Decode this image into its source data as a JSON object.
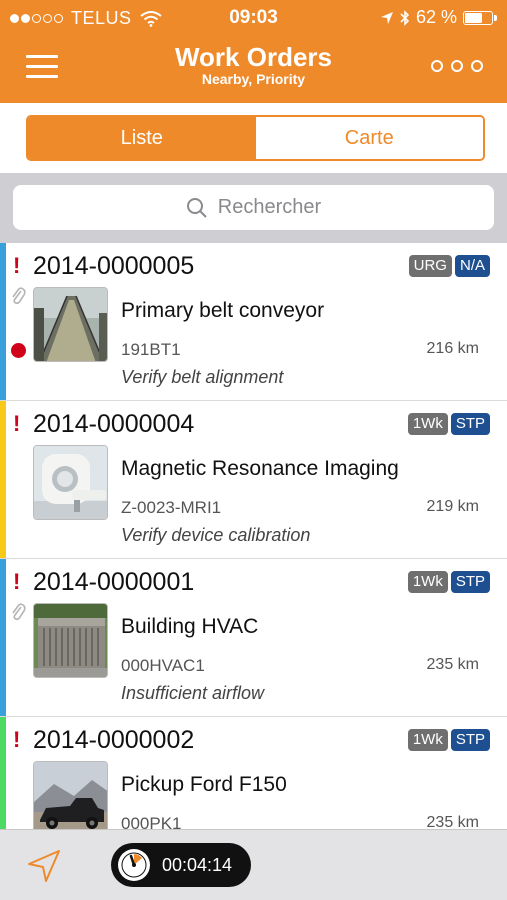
{
  "status_bar": {
    "carrier": "TELUS",
    "time": "09:03",
    "battery": "62 %",
    "battery_level": 0.62,
    "icons": [
      "signal-dots-icon",
      "wifi-icon",
      "location-arrow-icon",
      "bluetooth-icon",
      "battery-icon"
    ]
  },
  "header": {
    "title": "Work Orders",
    "subtitle": "Nearby, Priority",
    "menu_icon": "hamburger-icon",
    "more_icon": "ellipsis-icon"
  },
  "segments": [
    {
      "label": "Liste",
      "active": true
    },
    {
      "label": "Carte",
      "active": false
    }
  ],
  "search": {
    "placeholder": "Rechercher",
    "icon": "search-icon"
  },
  "colors": {
    "accent": "#ef8a2a",
    "priority_bar_blue": "#3aa0dc",
    "priority_bar_yellow": "#f7c918",
    "priority_bar_green": "#4cd964",
    "badge_grey": "#6f6f6f",
    "badge_navy": "#1d4f91",
    "urgent_red": "#d0021b"
  },
  "work_orders": [
    {
      "number": "2014-0000005",
      "badges": [
        "URG",
        "N/A"
      ],
      "name": "Primary belt conveyor",
      "code": "191BT1",
      "distance": "216 km",
      "description": "Verify belt alignment",
      "bar_color": "#3aa0dc",
      "has_attachment": true,
      "has_alarm": true,
      "thumb": "conveyor"
    },
    {
      "number": "2014-0000004",
      "badges": [
        "1Wk",
        "STP"
      ],
      "name": "Magnetic Resonance Imaging",
      "code": "Z-0023-MRI1",
      "distance": "219 km",
      "description": "Verify device calibration",
      "bar_color": "#f7c918",
      "has_attachment": false,
      "has_alarm": false,
      "thumb": "mri"
    },
    {
      "number": "2014-0000001",
      "badges": [
        "1Wk",
        "STP"
      ],
      "name": "Building HVAC",
      "code": "000HVAC1",
      "distance": "235 km",
      "description": "Insufficient airflow",
      "bar_color": "#3aa0dc",
      "has_attachment": true,
      "has_alarm": false,
      "thumb": "hvac"
    },
    {
      "number": "2014-0000002",
      "badges": [
        "1Wk",
        "STP"
      ],
      "name": "Pickup Ford F150",
      "code": "000PK1",
      "distance": "235 km",
      "description": "",
      "bar_color": "#4cd964",
      "has_attachment": false,
      "has_alarm": false,
      "thumb": "truck"
    }
  ],
  "toolbar": {
    "nav_icon": "navigation-arrow-icon",
    "timer": "00:04:14",
    "timer_icon": "stopwatch-icon"
  }
}
